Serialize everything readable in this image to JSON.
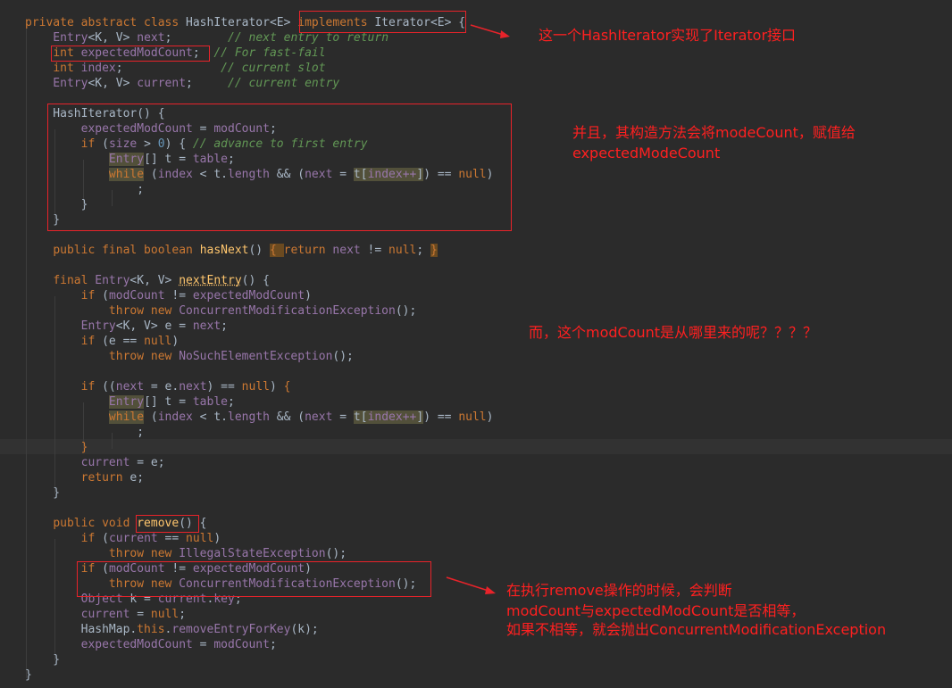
{
  "code_lines": [
    {
      "segments": [
        [
          "private abstract class ",
          "kw"
        ],
        [
          "HashIterator",
          "plain"
        ],
        [
          "<E> ",
          "plain"
        ],
        [
          "implements ",
          "kw"
        ],
        [
          "Iterator",
          "plain"
        ],
        [
          "<E>",
          "plain"
        ],
        [
          " {",
          "plain"
        ]
      ]
    },
    {
      "segments": [
        [
          "    Entry",
          "id"
        ],
        [
          "<K, V> ",
          "plain"
        ],
        [
          "next",
          "id"
        ],
        [
          ";        ",
          "plain"
        ],
        [
          "// next entry to return",
          "cm"
        ]
      ]
    },
    {
      "segments": [
        [
          "    ",
          "plain"
        ],
        [
          "int ",
          "kw"
        ],
        [
          "expectedModCount",
          "id"
        ],
        [
          ";  ",
          "plain"
        ],
        [
          "// For fast-fail",
          "cm"
        ]
      ]
    },
    {
      "segments": [
        [
          "    ",
          "plain"
        ],
        [
          "int ",
          "kw"
        ],
        [
          "index",
          "id"
        ],
        [
          ";              ",
          "plain"
        ],
        [
          "// current slot",
          "cm"
        ]
      ]
    },
    {
      "segments": [
        [
          "    Entry",
          "id"
        ],
        [
          "<K, V> ",
          "plain"
        ],
        [
          "current",
          "id"
        ],
        [
          ";     ",
          "plain"
        ],
        [
          "// current entry",
          "cm"
        ]
      ]
    },
    {
      "segments": [
        [
          "",
          "plain"
        ]
      ]
    },
    {
      "segments": [
        [
          "    HashIterator() {",
          "plain"
        ]
      ]
    },
    {
      "segments": [
        [
          "        ",
          "plain"
        ],
        [
          "expectedModCount",
          "id"
        ],
        [
          " = ",
          "plain"
        ],
        [
          "modCount",
          "id"
        ],
        [
          ";",
          "plain"
        ]
      ]
    },
    {
      "segments": [
        [
          "        ",
          "plain"
        ],
        [
          "if ",
          "kw"
        ],
        [
          "(",
          "plain"
        ],
        [
          "size",
          "id"
        ],
        [
          " > ",
          "plain"
        ],
        [
          "0",
          "num"
        ],
        [
          ") { ",
          "plain"
        ],
        [
          "// advance to first entry",
          "cm"
        ]
      ]
    },
    {
      "segments": [
        [
          "            ",
          "plain"
        ],
        [
          "Entry",
          "hl"
        ],
        [
          "[] t = ",
          "plain"
        ],
        [
          "table",
          "id"
        ],
        [
          ";",
          "plain"
        ]
      ]
    },
    {
      "segments": [
        [
          "            ",
          "plain"
        ],
        [
          "while",
          "hlk"
        ],
        [
          " (",
          "plain"
        ],
        [
          "index",
          "id"
        ],
        [
          " < t.",
          "plain"
        ],
        [
          "length",
          "id"
        ],
        [
          " && (",
          "plain"
        ],
        [
          "next",
          "id"
        ],
        [
          " = ",
          "plain"
        ],
        [
          "t[",
          "hlt"
        ],
        [
          "index++",
          "hli"
        ],
        [
          "]",
          "hlt"
        ],
        [
          ") == ",
          "plain"
        ],
        [
          "null",
          "kw"
        ],
        [
          ")",
          "plain"
        ]
      ]
    },
    {
      "segments": [
        [
          "                ;",
          "plain"
        ]
      ]
    },
    {
      "segments": [
        [
          "        }",
          "plain"
        ]
      ]
    },
    {
      "segments": [
        [
          "    }",
          "plain"
        ]
      ]
    },
    {
      "segments": [
        [
          "",
          "plain"
        ]
      ]
    },
    {
      "segments": [
        [
          "    ",
          "plain"
        ],
        [
          "public final boolean ",
          "kw"
        ],
        [
          "hasNext",
          "nm"
        ],
        [
          "() ",
          "plain"
        ],
        [
          "{ ",
          "hlb"
        ],
        [
          "return ",
          "kw"
        ],
        [
          "next",
          "id"
        ],
        [
          " != ",
          "plain"
        ],
        [
          "null",
          "kw"
        ],
        [
          ";",
          "plain"
        ],
        [
          " ",
          "plain"
        ],
        [
          "}",
          "hlb"
        ]
      ]
    },
    {
      "segments": [
        [
          "",
          "plain"
        ]
      ]
    },
    {
      "segments": [
        [
          "    ",
          "plain"
        ],
        [
          "final ",
          "kw"
        ],
        [
          "Entry",
          "id"
        ],
        [
          "<K, V> ",
          "plain"
        ],
        [
          "nextEntry",
          "ul"
        ],
        [
          "() {",
          "plain"
        ]
      ]
    },
    {
      "segments": [
        [
          "        ",
          "plain"
        ],
        [
          "if ",
          "kw"
        ],
        [
          "(",
          "plain"
        ],
        [
          "modCount",
          "id"
        ],
        [
          " != ",
          "plain"
        ],
        [
          "expectedModCount",
          "id"
        ],
        [
          ")",
          "plain"
        ]
      ]
    },
    {
      "segments": [
        [
          "            ",
          "plain"
        ],
        [
          "throw new ",
          "kw"
        ],
        [
          "ConcurrentModificationException",
          "id"
        ],
        [
          "();",
          "plain"
        ]
      ]
    },
    {
      "segments": [
        [
          "        Entry",
          "id"
        ],
        [
          "<K, V> e = ",
          "plain"
        ],
        [
          "next",
          "id"
        ],
        [
          ";",
          "plain"
        ]
      ]
    },
    {
      "segments": [
        [
          "        ",
          "plain"
        ],
        [
          "if ",
          "kw"
        ],
        [
          "(e == ",
          "plain"
        ],
        [
          "null",
          "kw"
        ],
        [
          ")",
          "plain"
        ]
      ]
    },
    {
      "segments": [
        [
          "            ",
          "plain"
        ],
        [
          "throw new ",
          "kw"
        ],
        [
          "NoSuchElementException",
          "id"
        ],
        [
          "();",
          "plain"
        ]
      ]
    },
    {
      "segments": [
        [
          "",
          "plain"
        ]
      ]
    },
    {
      "segments": [
        [
          "        ",
          "plain"
        ],
        [
          "if ",
          "kw"
        ],
        [
          "((",
          "plain"
        ],
        [
          "next",
          "id"
        ],
        [
          " = e.",
          "plain"
        ],
        [
          "next",
          "id"
        ],
        [
          ") == ",
          "plain"
        ],
        [
          "null",
          "kw"
        ],
        [
          ") ",
          "plain"
        ],
        [
          "{",
          "kw"
        ]
      ]
    },
    {
      "segments": [
        [
          "            ",
          "plain"
        ],
        [
          "Entry",
          "hl"
        ],
        [
          "[] t = ",
          "plain"
        ],
        [
          "table",
          "id"
        ],
        [
          ";",
          "plain"
        ]
      ]
    },
    {
      "segments": [
        [
          "            ",
          "plain"
        ],
        [
          "while",
          "hlk"
        ],
        [
          " (",
          "plain"
        ],
        [
          "index",
          "id"
        ],
        [
          " < t.",
          "plain"
        ],
        [
          "length",
          "id"
        ],
        [
          " && (",
          "plain"
        ],
        [
          "next",
          "id"
        ],
        [
          " = ",
          "plain"
        ],
        [
          "t[",
          "hlt"
        ],
        [
          "index++",
          "hli"
        ],
        [
          "]",
          "hlt"
        ],
        [
          ") == ",
          "plain"
        ],
        [
          "null",
          "kw"
        ],
        [
          ")",
          "plain"
        ]
      ]
    },
    {
      "segments": [
        [
          "                ;",
          "plain"
        ]
      ]
    },
    {
      "segments": [
        [
          "        ",
          "plain"
        ],
        [
          "}",
          "kw"
        ]
      ]
    },
    {
      "segments": [
        [
          "        ",
          "plain"
        ],
        [
          "current",
          "id"
        ],
        [
          " = e;",
          "plain"
        ]
      ]
    },
    {
      "segments": [
        [
          "        ",
          "plain"
        ],
        [
          "return ",
          "kw"
        ],
        [
          "e;",
          "plain"
        ]
      ]
    },
    {
      "segments": [
        [
          "    }",
          "plain"
        ]
      ]
    },
    {
      "segments": [
        [
          "",
          "plain"
        ]
      ]
    },
    {
      "segments": [
        [
          "    ",
          "plain"
        ],
        [
          "public void ",
          "kw"
        ],
        [
          "remove",
          "nm"
        ],
        [
          "() {",
          "plain"
        ]
      ]
    },
    {
      "segments": [
        [
          "        ",
          "plain"
        ],
        [
          "if ",
          "kw"
        ],
        [
          "(",
          "plain"
        ],
        [
          "current",
          "id"
        ],
        [
          " == ",
          "plain"
        ],
        [
          "null",
          "kw"
        ],
        [
          ")",
          "plain"
        ]
      ]
    },
    {
      "segments": [
        [
          "            ",
          "plain"
        ],
        [
          "throw new ",
          "kw"
        ],
        [
          "IllegalStateException",
          "id"
        ],
        [
          "();",
          "plain"
        ]
      ]
    },
    {
      "segments": [
        [
          "        ",
          "plain"
        ],
        [
          "if ",
          "kw"
        ],
        [
          "(",
          "plain"
        ],
        [
          "modCount",
          "id"
        ],
        [
          " != ",
          "plain"
        ],
        [
          "expectedModCount",
          "id"
        ],
        [
          ")",
          "plain"
        ]
      ]
    },
    {
      "segments": [
        [
          "            ",
          "plain"
        ],
        [
          "throw new ",
          "kw"
        ],
        [
          "ConcurrentModificationException",
          "id"
        ],
        [
          "();",
          "plain"
        ]
      ]
    },
    {
      "segments": [
        [
          "        Object",
          "id"
        ],
        [
          " k = ",
          "plain"
        ],
        [
          "current",
          "id"
        ],
        [
          ".",
          "plain"
        ],
        [
          "key",
          "id"
        ],
        [
          ";",
          "plain"
        ]
      ]
    },
    {
      "segments": [
        [
          "        ",
          "plain"
        ],
        [
          "current",
          "id"
        ],
        [
          " = ",
          "plain"
        ],
        [
          "null",
          "kw"
        ],
        [
          ";",
          "plain"
        ]
      ]
    },
    {
      "segments": [
        [
          "        HashMap.",
          "plain"
        ],
        [
          "this",
          "kw"
        ],
        [
          ".",
          "plain"
        ],
        [
          "removeEntryForKey",
          "id"
        ],
        [
          "(k);",
          "plain"
        ]
      ]
    },
    {
      "segments": [
        [
          "        ",
          "plain"
        ],
        [
          "expectedModCount",
          "id"
        ],
        [
          " = ",
          "plain"
        ],
        [
          "modCount",
          "id"
        ],
        [
          ";",
          "plain"
        ]
      ]
    },
    {
      "segments": [
        [
          "    }",
          "plain"
        ]
      ]
    },
    {
      "segments": [
        [
          "}",
          "plain"
        ]
      ]
    }
  ],
  "annotations": {
    "note1": "这一个HashIterator实现了Iterator接口",
    "note2_line1": "并且，其构造方法会将modeCount，赋值给",
    "note2_line2": "expectedModeCount",
    "note3": "而，这个modCount是从哪里来的呢？？？？",
    "note4_line1": "在执行remove操作的时候，会判断",
    "note4_line2": "modCount与expectedModCount是否相等，",
    "note4_line3": "如果不相等，就会抛出ConcurrentModificationException"
  },
  "colors": {
    "background": "#2b2b2b",
    "keyword": "#cc7832",
    "identifier": "#9876aa",
    "comment": "#629755",
    "annotation_red": "#ff2020"
  }
}
